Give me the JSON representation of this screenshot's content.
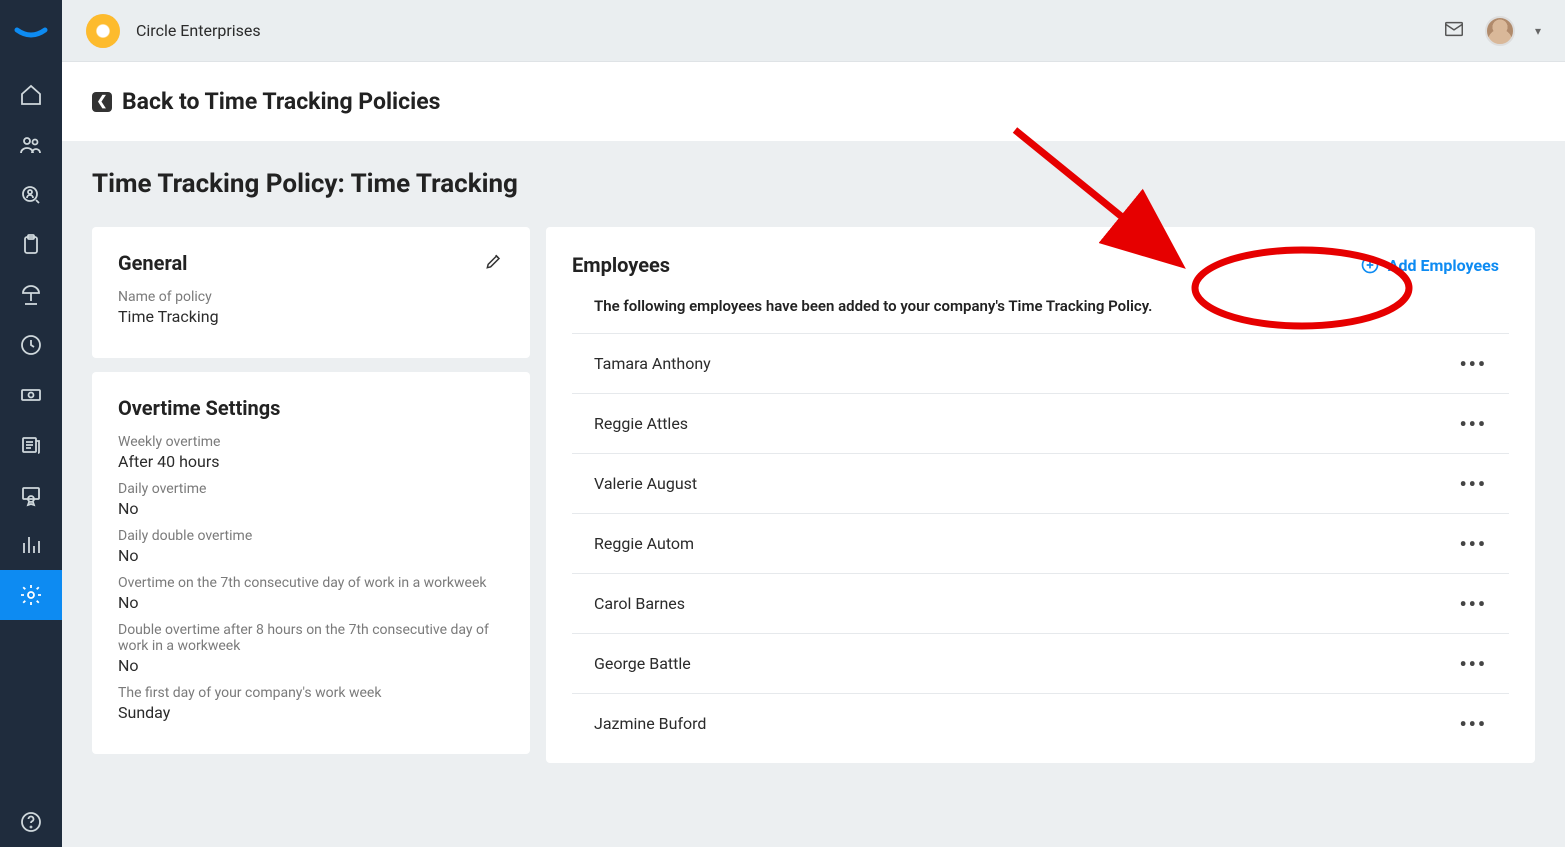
{
  "header": {
    "company_name": "Circle Enterprises"
  },
  "back": {
    "label": "Back to Time Tracking Policies"
  },
  "page": {
    "title": "Time Tracking Policy: Time Tracking"
  },
  "general": {
    "section_title": "General",
    "policy_name_label": "Name of policy",
    "policy_name_value": "Time Tracking"
  },
  "overtime": {
    "section_title": "Overtime Settings",
    "weekly_label": "Weekly overtime",
    "weekly_value": "After 40 hours",
    "daily_label": "Daily overtime",
    "daily_value": "No",
    "double_label": "Daily double overtime",
    "double_value": "No",
    "seventh_label": "Overtime on the 7th consecutive day of work in a workweek",
    "seventh_value": "No",
    "double_seventh_label": "Double overtime after 8 hours on the 7th consecutive day of work in a workweek",
    "double_seventh_value": "No",
    "first_day_label": "The first day of your company's work week",
    "first_day_value": "Sunday"
  },
  "employees_card": {
    "title": "Employees",
    "add_label": "Add Employees",
    "note": "The following employees have been added to your company's Time Tracking Policy.",
    "rows": [
      {
        "name": "Tamara Anthony"
      },
      {
        "name": "Reggie Attles"
      },
      {
        "name": "Valerie August"
      },
      {
        "name": "Reggie Autom"
      },
      {
        "name": "Carol Barnes"
      },
      {
        "name": "George Battle"
      },
      {
        "name": "Jazmine Buford"
      }
    ]
  }
}
